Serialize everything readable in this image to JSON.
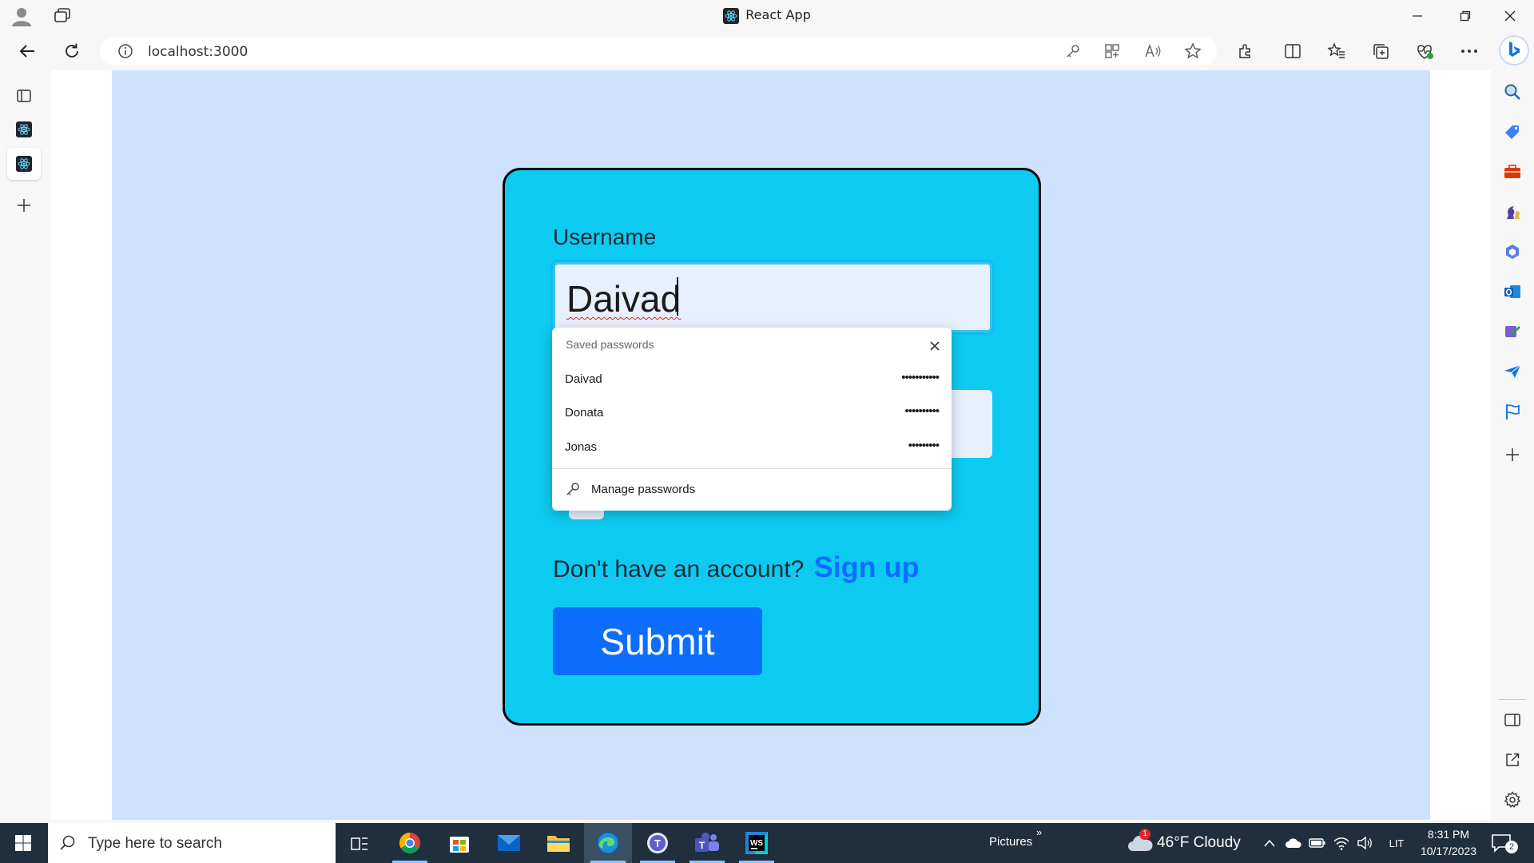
{
  "browser": {
    "window_title": "React App",
    "url": "localhost:3000"
  },
  "form": {
    "username_label": "Username",
    "username_value": "Daivad",
    "signup_prompt": "Don't have an account?",
    "signup_link": "Sign up",
    "submit_label": "Submit"
  },
  "password_popup": {
    "header": "Saved passwords",
    "entries": [
      {
        "user": "Daivad",
        "dots": "•••••••••••"
      },
      {
        "user": "Donata",
        "dots": "••••••••••"
      },
      {
        "user": "Jonas",
        "dots": "•••••••••"
      }
    ],
    "manage_label": "Manage passwords"
  },
  "taskbar": {
    "search_placeholder": "Type here to search",
    "pictures_label": "Pictures",
    "weather_text": "46°F  Cloudy",
    "weather_badge": "1",
    "language": "LIT",
    "time": "8:31 PM",
    "date": "10/17/2023",
    "notification_count": "2"
  },
  "colors": {
    "page_bg": "#cfe2fd",
    "card_bg": "#0dcaf0",
    "primary": "#0d6efd",
    "taskbar_bg": "#1f2f3d"
  }
}
